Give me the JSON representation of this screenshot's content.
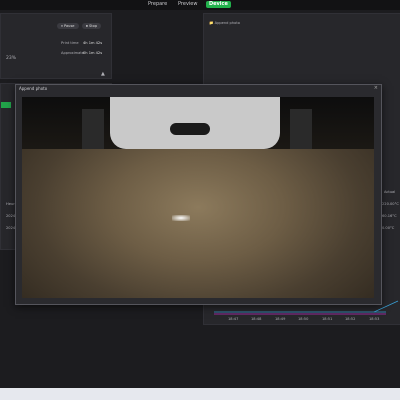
{
  "topnav": {
    "prepare": "Prepare",
    "preview": "Preview",
    "device": "Device"
  },
  "left_panel": {
    "pause": "Pause",
    "stop": "Stop",
    "percent": "23%",
    "time1_label": "Print time",
    "time1_value": "4h 1m 42s",
    "time2_label": "Approximate",
    "time2_value": "0h 1m 42s",
    "table_header": "Heure",
    "row1": "2024 0",
    "row2": "2024 0"
  },
  "right_panel": {
    "title": "Append photo",
    "col_header": "Actual",
    "temps": [
      "220.00°C",
      "60.16°C",
      "0.00°C"
    ],
    "x_ticks": [
      "18:47",
      "18:48",
      "18:49",
      "18:50",
      "18:51",
      "18:52",
      "18:53"
    ]
  },
  "modal": {
    "title": "Append photo",
    "close": "×"
  },
  "colors": {
    "accent": "#22b14c",
    "line_series": "#3aa0d6",
    "line_series2": "#c02cc0"
  }
}
